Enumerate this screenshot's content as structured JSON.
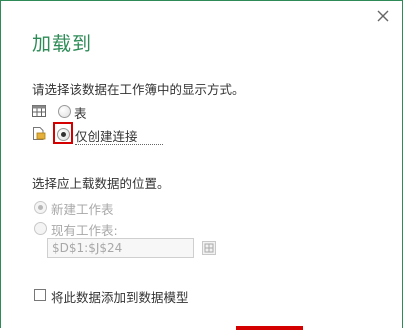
{
  "dialog": {
    "title": "加载到",
    "view_prompt": "请选择该数据在工作簿中的显示方式。",
    "options": [
      {
        "label": "表",
        "selected": false,
        "icon": "table-icon"
      },
      {
        "label": "仅创建连接",
        "selected": true,
        "icon": "connection-only-icon"
      }
    ],
    "location_prompt": "选择应上载数据的位置。",
    "location_options": [
      {
        "label": "新建工作表",
        "selected": true,
        "disabled": true
      },
      {
        "label": "现有工作表:",
        "selected": false,
        "disabled": true
      }
    ],
    "range_value": "$D$1:$J$24",
    "add_to_model_label": "将此数据添加到数据模型",
    "add_to_model_checked": false
  },
  "colors": {
    "accent": "#2e8b57",
    "highlight": "#d40000"
  }
}
